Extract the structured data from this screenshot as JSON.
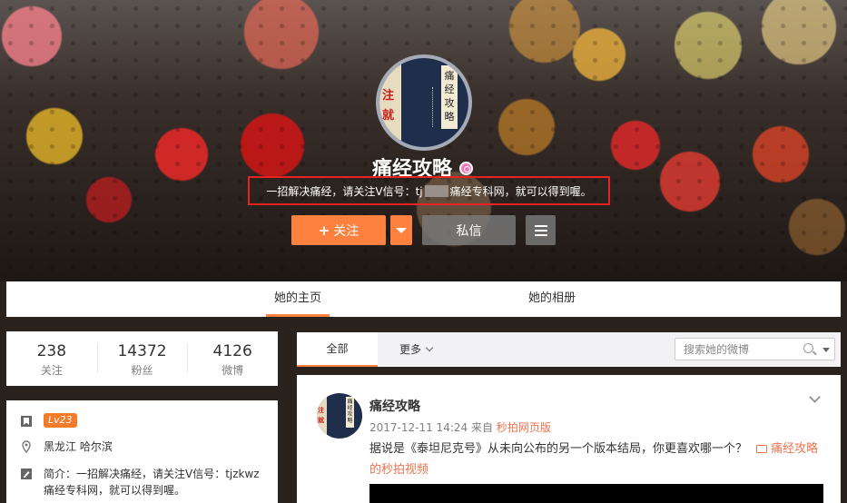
{
  "profile": {
    "name": "痛经攻略",
    "intro_prefix": "一招解决痛经，请关注V信号：tj",
    "intro_suffix": "痛经专科网，就可以得到喔。",
    "avatar_left_text": [
      "注",
      "就"
    ],
    "avatar_label": "痛经攻略"
  },
  "actions": {
    "follow_label": "关注",
    "message_label": "私信"
  },
  "tabs": {
    "home": "她的主页",
    "album": "她的相册"
  },
  "stats": [
    {
      "num": "238",
      "label": "关注"
    },
    {
      "num": "14372",
      "label": "粉丝"
    },
    {
      "num": "4126",
      "label": "微博"
    }
  ],
  "info": {
    "level": "Lv23",
    "location": "黑龙江 哈尔滨",
    "bio": "简介：一招解决痛经，请关注V信号：tjzkwz 痛经专科网，就可以得到喔。"
  },
  "feed": {
    "tab_all": "全部",
    "tab_more": "更多",
    "search_placeholder": "搜索她的微博"
  },
  "post": {
    "author": "痛经攻略",
    "time": "2017-12-11 14:24",
    "from_prefix": "来自",
    "source": "秒拍网页版",
    "text": "据说是《泰坦尼克号》从未向公布的另一个版本结局，你更喜欢哪一个？",
    "video_link": "痛经攻略的秒拍视频"
  },
  "colors": {
    "accent": "#ff8140",
    "highlight_border": "#e8231f",
    "link": "#eb7350",
    "level_badge": "#f37b2a"
  }
}
